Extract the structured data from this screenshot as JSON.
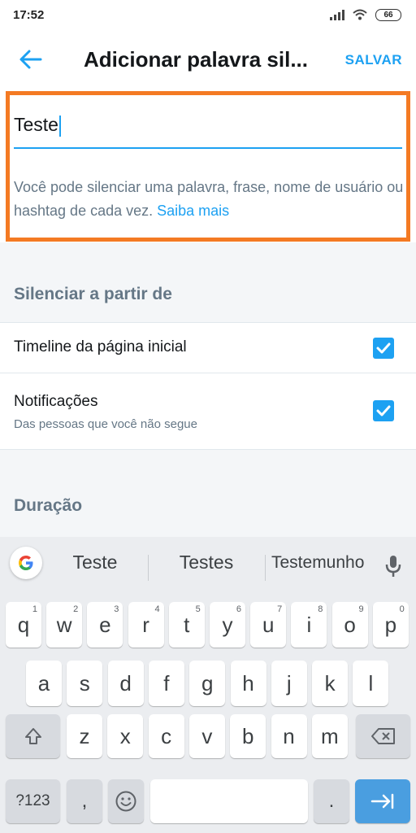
{
  "status": {
    "time": "17:52",
    "battery": "66"
  },
  "header": {
    "title": "Adicionar palavra sil...",
    "save_label": "SALVAR"
  },
  "input": {
    "value": "Teste"
  },
  "helper": {
    "text": "Você pode silenciar uma palavra, frase, nome de usuário ou hashtag de cada vez.",
    "link": "Saiba mais"
  },
  "mute_from": {
    "title": "Silenciar a partir de",
    "items": [
      {
        "label": "Timeline da página inicial",
        "checked": true
      },
      {
        "label": "Notificações",
        "sublabel": "Das pessoas que você não segue",
        "checked": true
      }
    ]
  },
  "duration": {
    "title": "Duração"
  },
  "keyboard": {
    "suggestions": [
      "Teste",
      "Testes",
      "Testemunho"
    ],
    "row1": [
      {
        "k": "q",
        "n": "1"
      },
      {
        "k": "w",
        "n": "2"
      },
      {
        "k": "e",
        "n": "3"
      },
      {
        "k": "r",
        "n": "4"
      },
      {
        "k": "t",
        "n": "5"
      },
      {
        "k": "y",
        "n": "6"
      },
      {
        "k": "u",
        "n": "7"
      },
      {
        "k": "i",
        "n": "8"
      },
      {
        "k": "o",
        "n": "9"
      },
      {
        "k": "p",
        "n": "0"
      }
    ],
    "row2": [
      "a",
      "s",
      "d",
      "f",
      "g",
      "h",
      "j",
      "k",
      "l"
    ],
    "row3": [
      "z",
      "x",
      "c",
      "v",
      "b",
      "n",
      "m"
    ],
    "symbols_label": "?123",
    "comma": ",",
    "period": "."
  },
  "colors": {
    "accent": "#1da1f2",
    "highlight": "#f47a23"
  },
  "icons": [
    "back-arrow-icon",
    "checkbox-checked-icon",
    "google-icon",
    "mic-icon",
    "shift-icon",
    "backspace-icon",
    "emoji-icon",
    "enter-icon"
  ]
}
